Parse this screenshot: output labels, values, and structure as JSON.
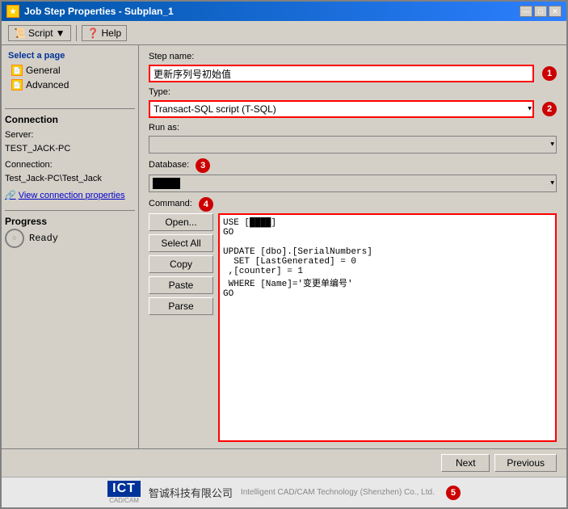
{
  "window": {
    "title": "Job Step Properties - Subplan_1",
    "icon": "★"
  },
  "title_buttons": {
    "minimize": "—",
    "maximize": "□",
    "close": "✕"
  },
  "toolbar": {
    "script_label": "Script",
    "help_label": "Help",
    "dropdown_arrow": "▼"
  },
  "sidebar": {
    "title": "Select a page",
    "items": [
      {
        "label": "General",
        "icon": "📄"
      },
      {
        "label": "Advanced",
        "icon": "📄"
      }
    ]
  },
  "form": {
    "step_name_label": "Step name:",
    "step_name_value": "更新序列号初始值",
    "badge1": "1",
    "type_label": "Type:",
    "type_value": "Transact-SQL script (T-SQL)",
    "badge2": "2",
    "run_as_label": "Run as:",
    "database_label": "Database:",
    "badge3": "3",
    "database_value": "████",
    "command_label": "Command:",
    "badge4": "4",
    "command_text": "USE [████]\nGO\n\nUPDATE [dbo].[SerialNumbers]\n  SET [LastGenerated] = 0\n ,[counter] = 1\n WHERE [Name]='变更单编号'\nGO",
    "open_btn": "Open...",
    "select_all_btn": "Select All",
    "copy_btn": "Copy",
    "paste_btn": "Paste",
    "parse_btn": "Parse"
  },
  "connection": {
    "title": "Connection",
    "server_label": "Server:",
    "server_value": "TEST_JACK-PC",
    "connection_label": "Connection:",
    "connection_value": "Test_Jack-PC\\Test_Jack",
    "view_link": "View connection properties"
  },
  "progress": {
    "title": "Progress",
    "status": "Ready"
  },
  "footer": {
    "next_btn": "Next",
    "previous_btn": "Previous"
  },
  "watermark": {
    "ict_text": "ICT",
    "cad_cam": "CAD/CAM",
    "company": "智诚科技有限公司",
    "subtitle": "Intelligent CAD/CAM Technology (Shenzhen) Co., Ltd.",
    "badge5": "5"
  }
}
